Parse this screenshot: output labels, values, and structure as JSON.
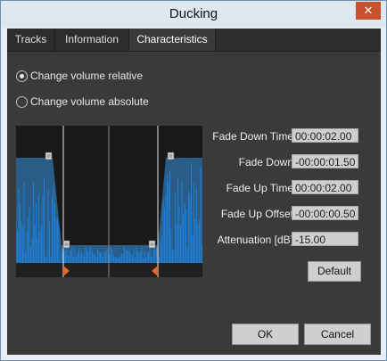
{
  "window": {
    "title": "Ducking",
    "close_glyph": "✕"
  },
  "tabs": [
    {
      "label": "Tracks"
    },
    {
      "label": "Information"
    },
    {
      "label": "Characteristics"
    }
  ],
  "mode": {
    "relative_label": "Change volume relative",
    "absolute_label": "Change volume absolute",
    "selected": "relative"
  },
  "fields": {
    "fade_down_time": {
      "label": "Fade Down Time",
      "value": "00:00:02.00"
    },
    "fade_down": {
      "label": "Fade Down",
      "value": "-00:00:01.50"
    },
    "fade_up_time": {
      "label": "Fade Up Time",
      "value": "00:00:02.00"
    },
    "fade_up_offset": {
      "label": "Fade Up Offset",
      "value": "-00:00:00.50"
    },
    "attenuation": {
      "label": "Attenuation [dB]",
      "value": "-15.00"
    }
  },
  "buttons": {
    "default_label": "Default",
    "ok_label": "OK",
    "cancel_label": "Cancel"
  },
  "colors": {
    "waveform": "#1f7fd6",
    "envelope": "#2a5c88",
    "marker": "#e8642c"
  }
}
